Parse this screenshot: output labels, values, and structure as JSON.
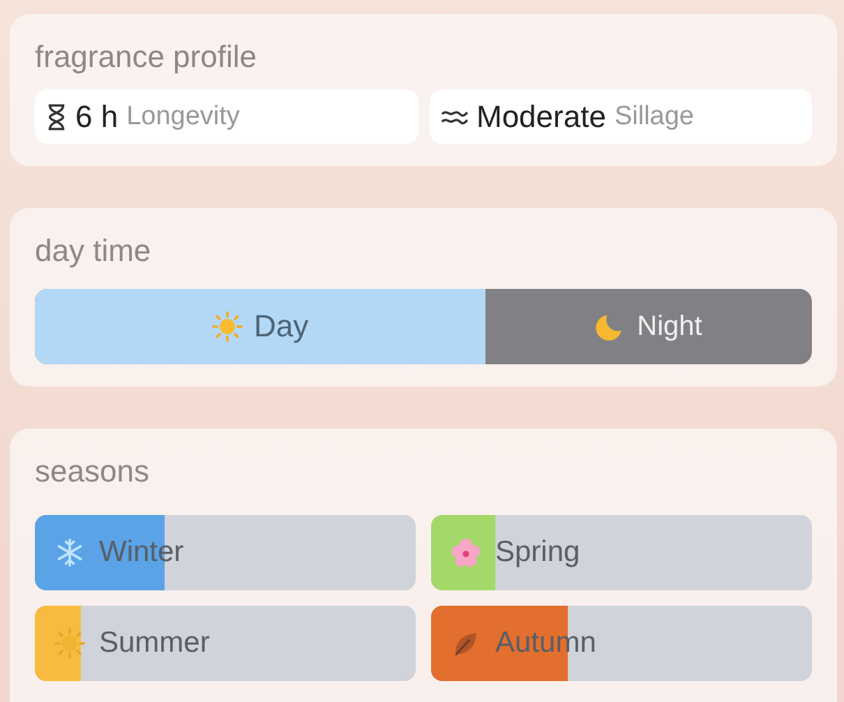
{
  "profile": {
    "title": "fragrance profile",
    "items": [
      {
        "kind": "hourglass",
        "value": "6 h",
        "label": "Longevity"
      },
      {
        "kind": "waves",
        "value": "Moderate",
        "label": "Sillage"
      }
    ]
  },
  "day_time": {
    "title": "day time",
    "level": 0.58,
    "segments": [
      {
        "kind": "sun",
        "label": "Day"
      },
      {
        "kind": "moon",
        "label": "Night"
      }
    ]
  },
  "seasons": {
    "title": "seasons",
    "items": [
      {
        "kind": "snowflake",
        "label": "Winter",
        "level": 0.34,
        "color": "#5aa3e6"
      },
      {
        "kind": "blossom",
        "label": "Spring",
        "level": 0.17,
        "color": "#a4d96a"
      },
      {
        "kind": "sun",
        "label": "Summer",
        "level": 0.12,
        "color": "#f8bb40"
      },
      {
        "kind": "leaf",
        "label": "Autumn",
        "level": 0.36,
        "color": "#e26f2d"
      }
    ]
  }
}
